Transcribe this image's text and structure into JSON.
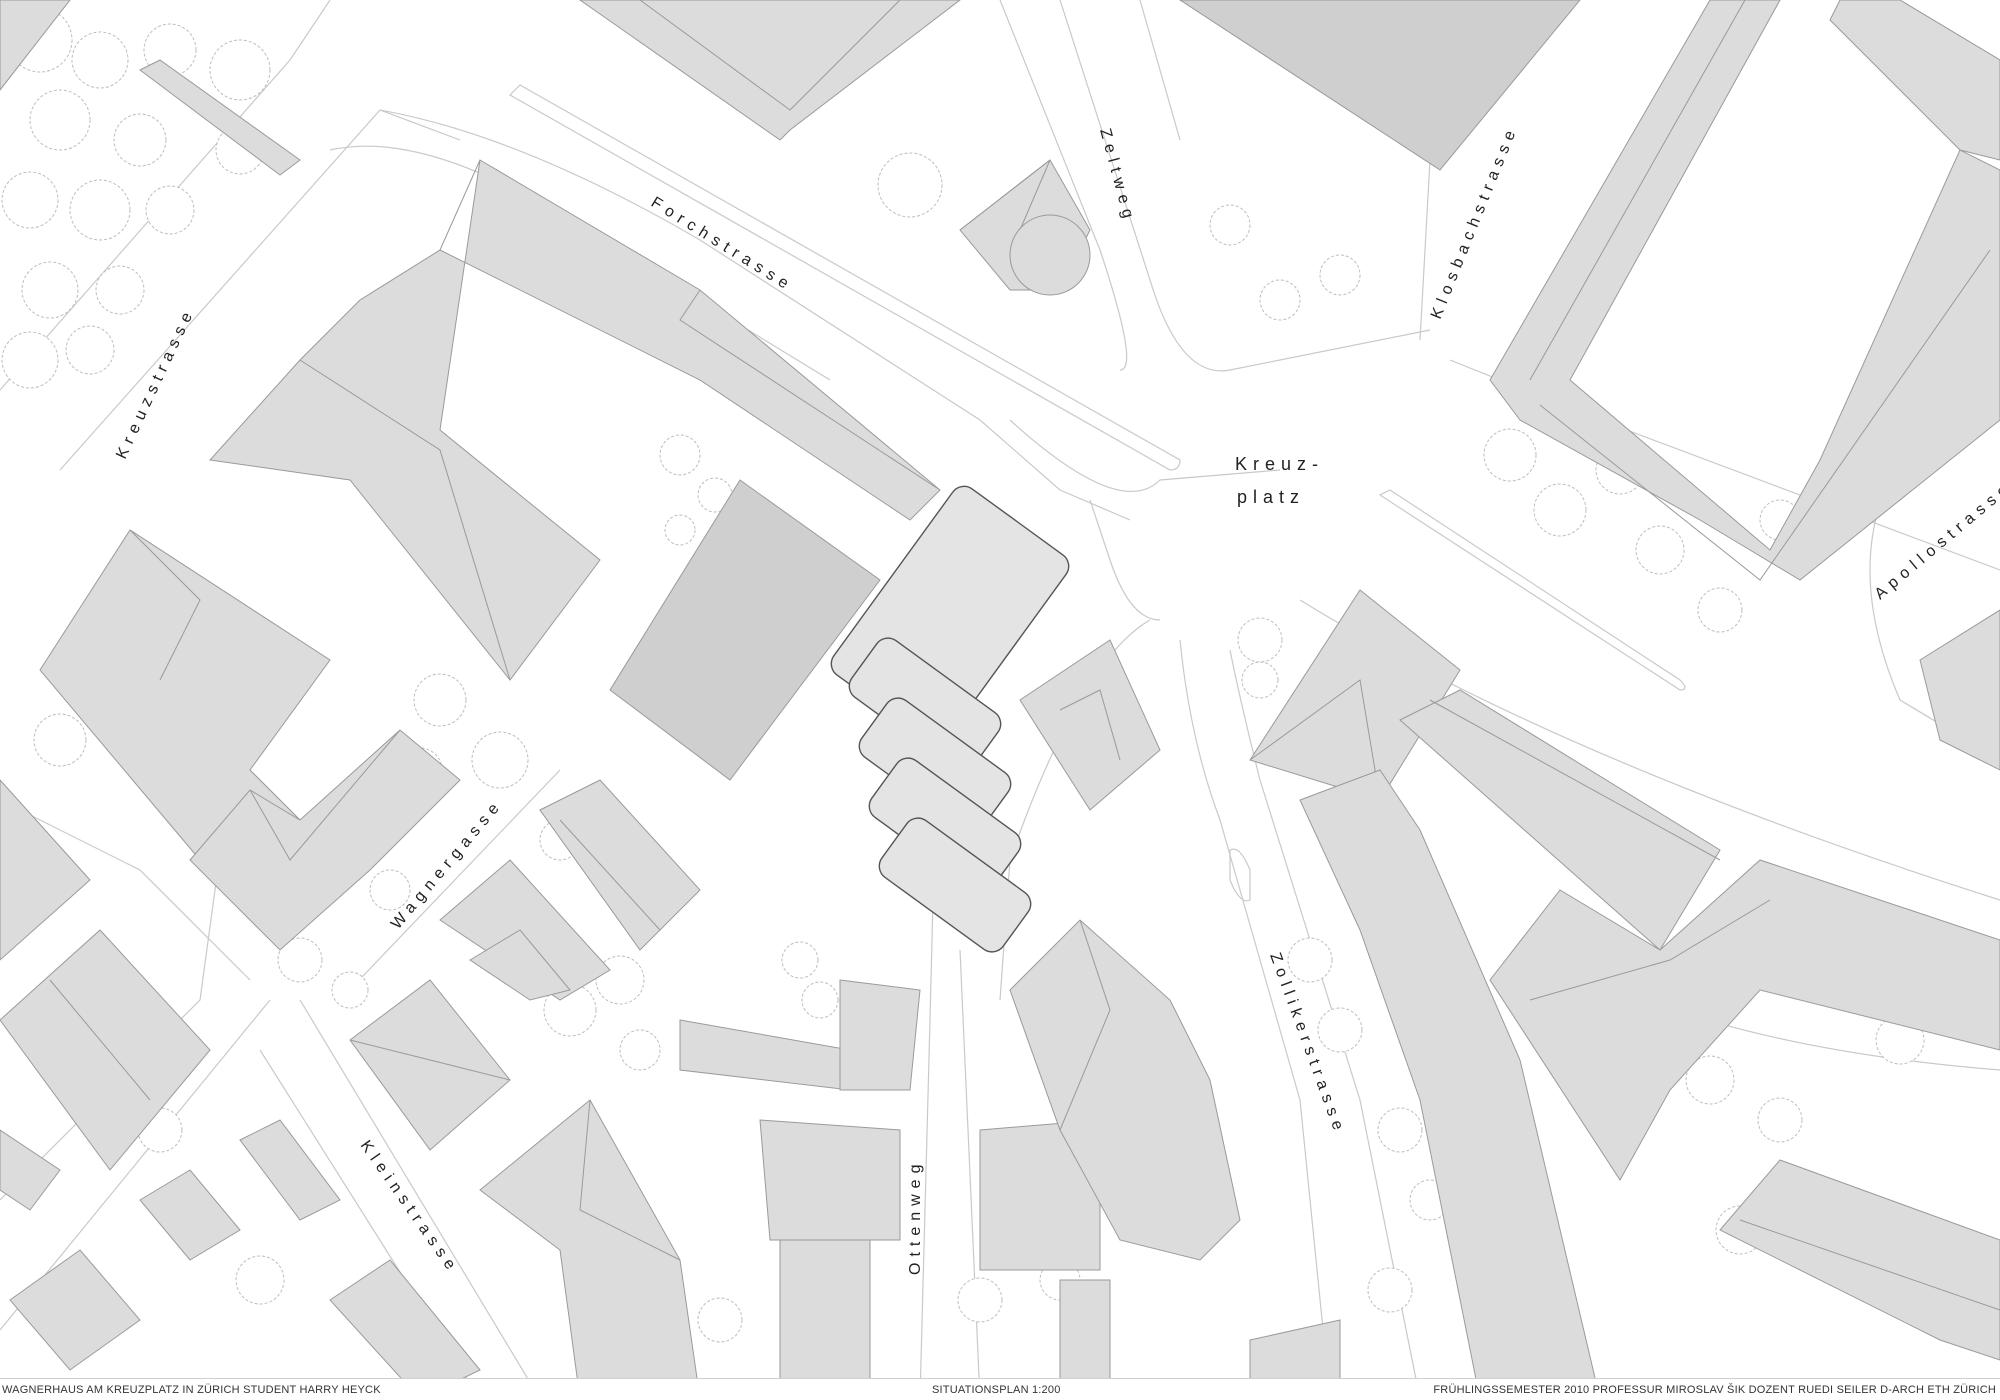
{
  "map": {
    "streets": [
      {
        "id": "forchstrasse",
        "label": "Forchstrasse"
      },
      {
        "id": "zeltweg",
        "label": "Zeltweg"
      },
      {
        "id": "klosbachstrasse",
        "label": "Klosbachstrasse"
      },
      {
        "id": "kreuzstrasse",
        "label": "Kreuzstrasse"
      },
      {
        "id": "apollostrasse",
        "label": "Apollostrasse"
      },
      {
        "id": "wagnergasse",
        "label": "Wagnergasse"
      },
      {
        "id": "zollikerstrasse",
        "label": "Zollikerstrasse"
      },
      {
        "id": "kleinstrasse",
        "label": "Kleinstrasse"
      },
      {
        "id": "ottenweg",
        "label": "Ottenweg"
      }
    ],
    "plaza": {
      "line1": "Kreuz-",
      "line2": "platz"
    }
  },
  "footer": {
    "left": "WAGNERHAUS AM KREUZPLATZ IN ZÜRICH   STUDENT HARRY HEYCK",
    "center": "SITUATIONSPLAN 1:200",
    "right": "FRÜHLINGSSEMESTER 2010   PROFESSUR MIROSLAV ŠIK   DOZENT RUEDI SEILER   D-ARCH   ETH ZÜRICH"
  }
}
